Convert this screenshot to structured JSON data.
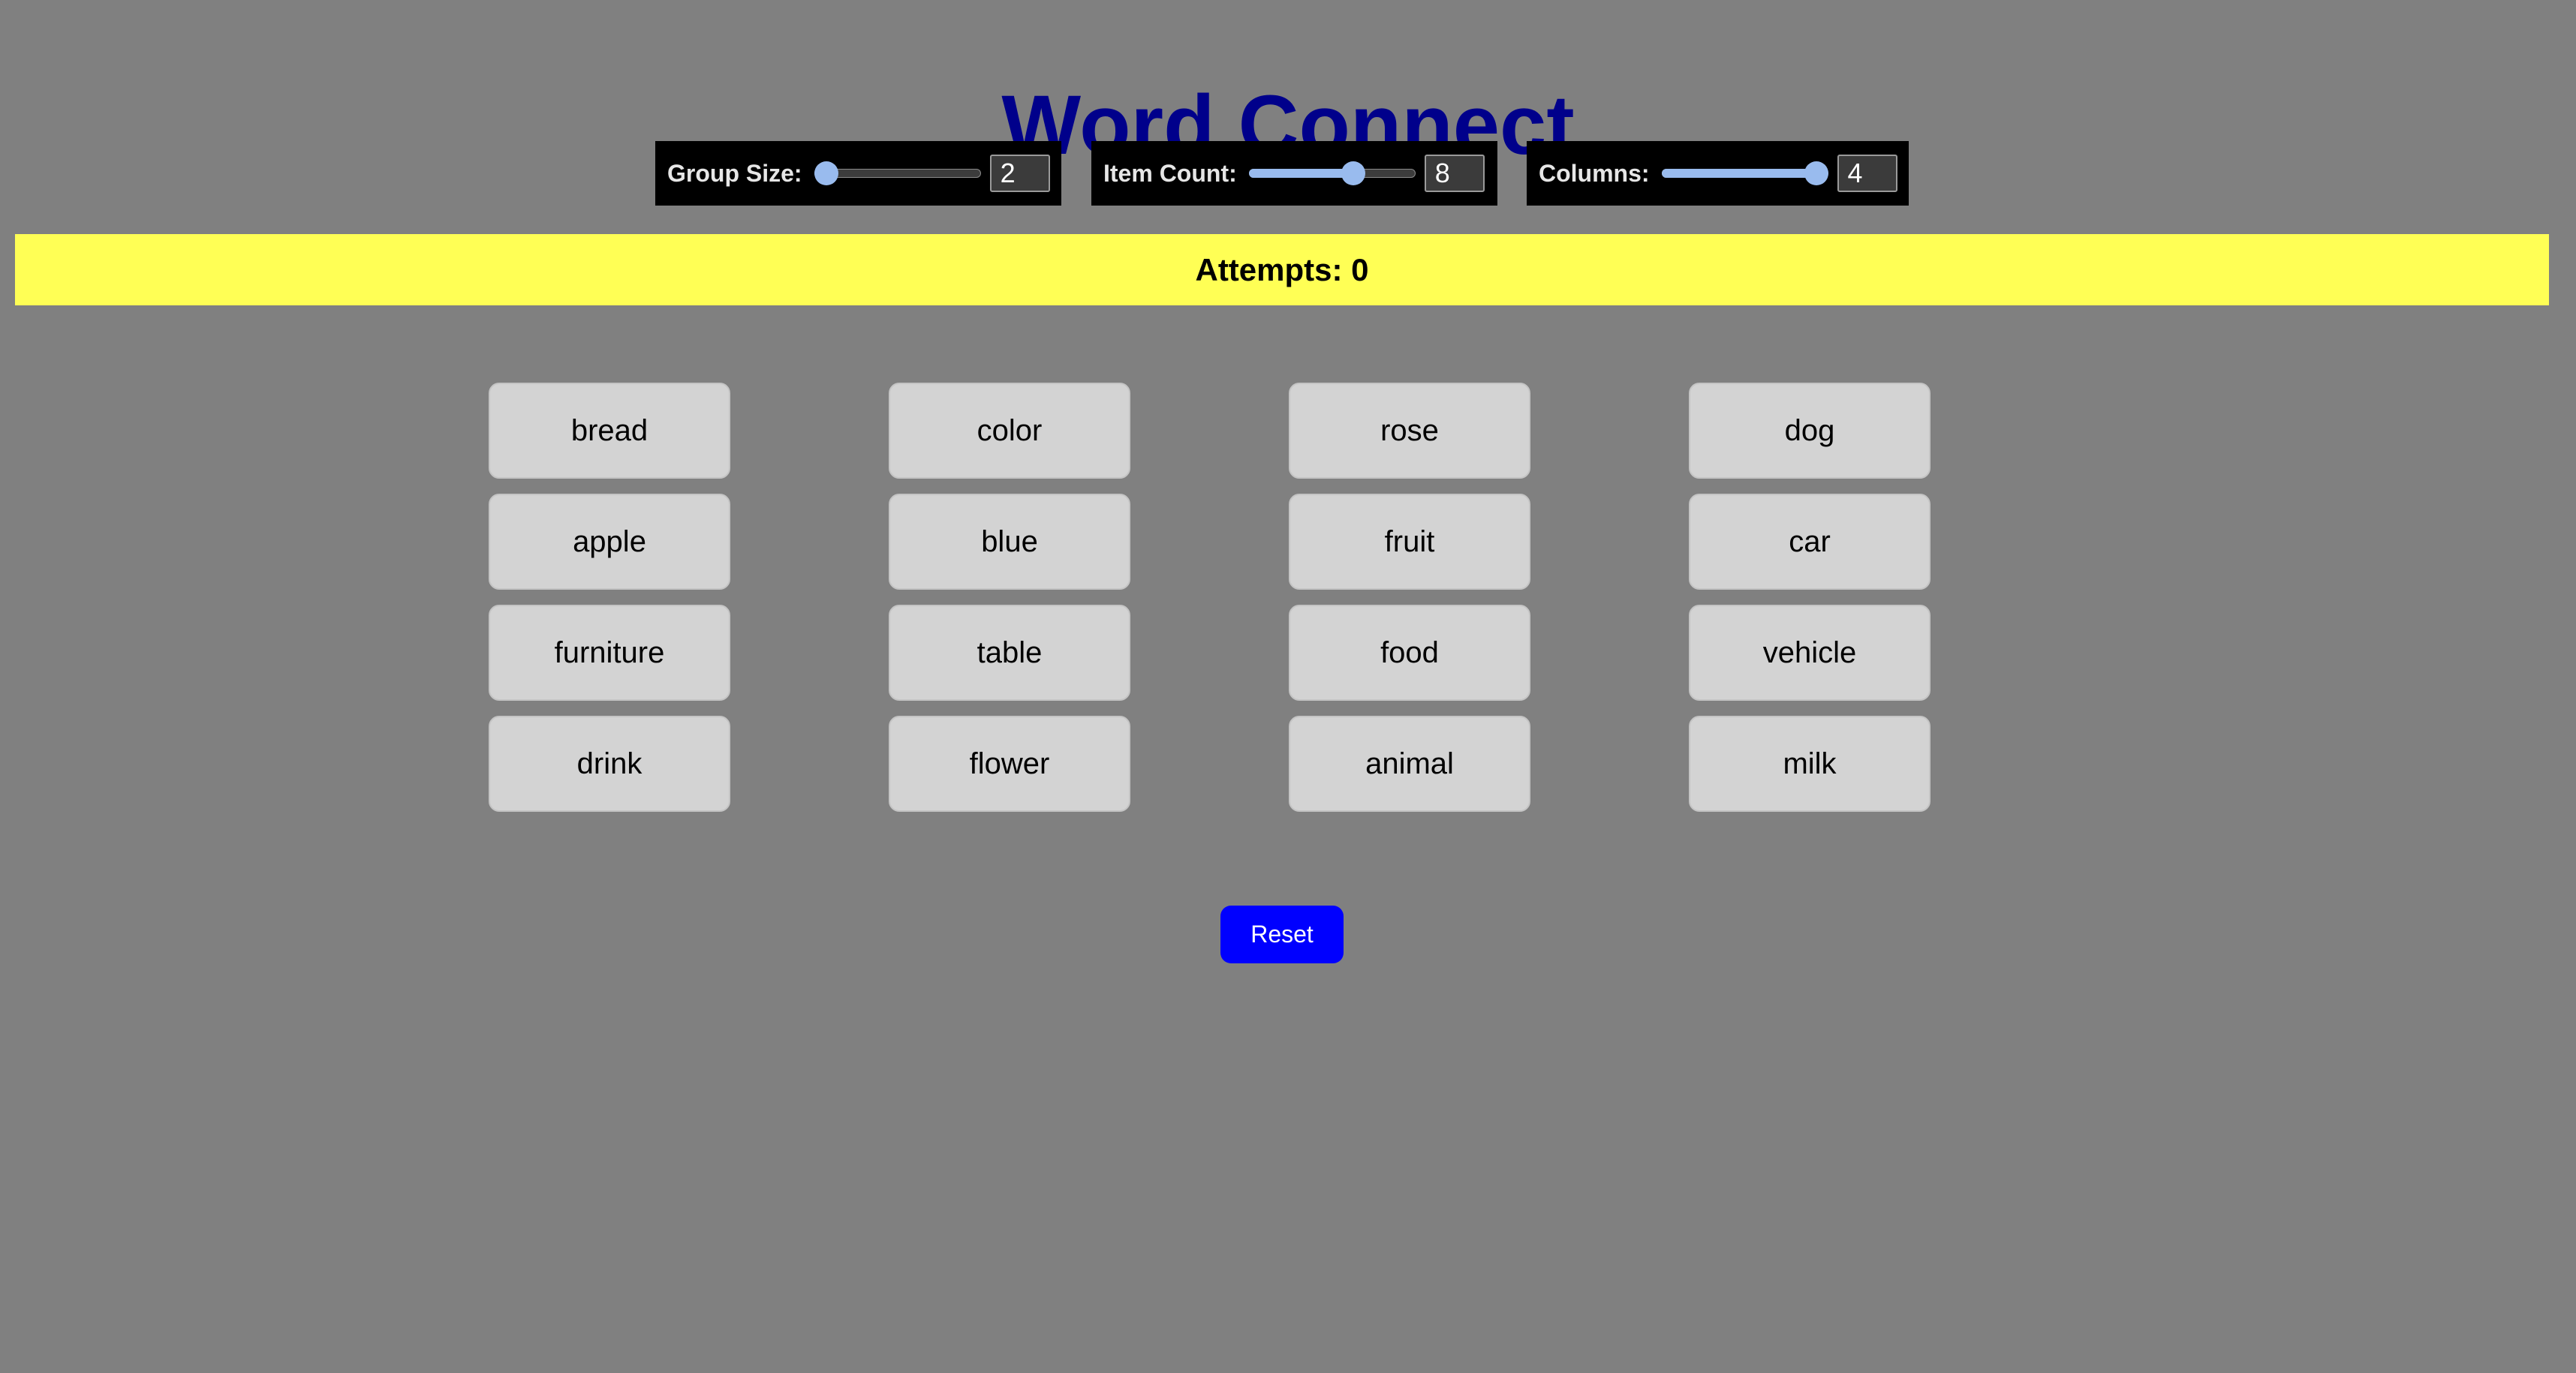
{
  "title": "Word Connect",
  "controls": {
    "group_size": {
      "label": "Group Size:",
      "value": "2",
      "fraction": 0.0
    },
    "item_count": {
      "label": "Item Count:",
      "value": "8",
      "fraction": 0.65
    },
    "columns": {
      "label": "Columns:",
      "value": "4",
      "fraction": 1.0
    }
  },
  "status": {
    "attempts_text": "Attempts: 0"
  },
  "cards": [
    "bread",
    "color",
    "rose",
    "dog",
    "apple",
    "blue",
    "fruit",
    "car",
    "furniture",
    "table",
    "food",
    "vehicle",
    "drink",
    "flower",
    "animal",
    "milk"
  ],
  "reset_label": "Reset",
  "colors": {
    "background": "#808080",
    "title": "#00008b",
    "status_bar": "#ffff55",
    "card": "#d3d3d3",
    "reset_button": "#0000ff",
    "slider_accent": "#99bbee"
  }
}
